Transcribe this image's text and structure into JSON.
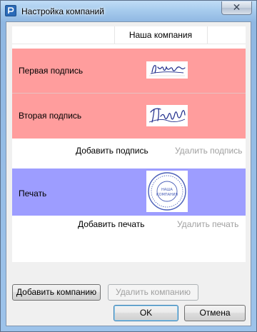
{
  "window": {
    "title": "Настройка компаний",
    "close_glyph": "✕",
    "icons": {
      "app": "app-icon",
      "close": "close-icon"
    }
  },
  "table": {
    "column_header": "Наша компания",
    "rows": [
      {
        "label": "Первая подпись",
        "image": "signature-image",
        "color": "#ff9d9d"
      },
      {
        "label": "Вторая подпись",
        "image": "signature-image",
        "color": "#ff9d9d"
      },
      {
        "label": "Печать",
        "image": "stamp-image",
        "color": "#9d9dff"
      }
    ],
    "stamp_text": [
      "НАША",
      "КОМПАНИЯ"
    ]
  },
  "actions": {
    "add_signature": "Добавить подпись",
    "delete_signature": "Удалить подпись",
    "add_stamp": "Добавить печать",
    "delete_stamp": "Удалить печать"
  },
  "buttons": {
    "add_company": "Добавить компанию",
    "delete_company": "Удалить компанию",
    "ok": "OK",
    "cancel": "Отмена"
  }
}
